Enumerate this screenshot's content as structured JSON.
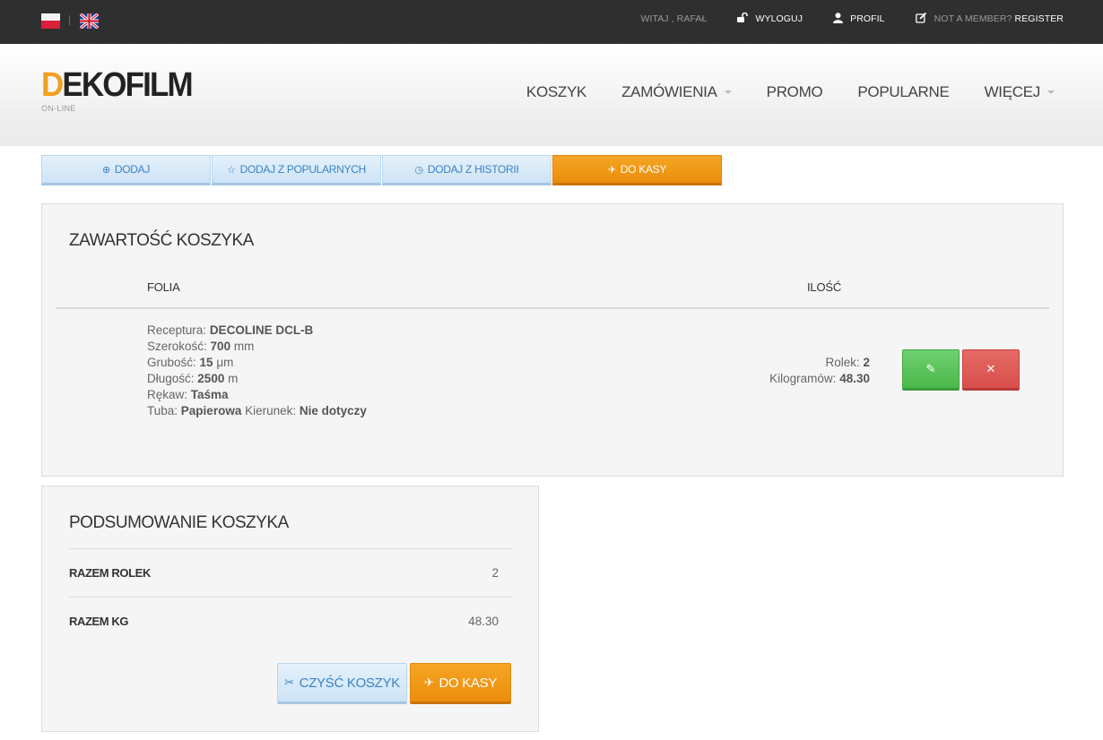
{
  "topbar": {
    "languages": [
      "pl-flag-icon",
      "uk-flag-icon"
    ],
    "greeting": "WITAJ , RAFAŁ",
    "logout_label": "WYLOGUJ",
    "logout_icon": "unlock-icon",
    "profile_label": "PROFIL",
    "profile_icon": "user-icon",
    "member_prefix": "NOT A MEMBER?",
    "register_label": "REGISTER",
    "register_icon": "edit-icon"
  },
  "header": {
    "logo_first": "D",
    "logo_rest": "EKOFILM",
    "logo_sub": "ON-LINE",
    "nav": {
      "koszyk": "KOSZYK",
      "zamowienia": "ZAMÓWIENIA",
      "promo": "PROMO",
      "popularne": "POPULARNE",
      "wiecej": "WIĘCEJ"
    }
  },
  "actions": {
    "add": {
      "icon": "⊕",
      "label": "DODAJ"
    },
    "add_popular": {
      "icon": "☆",
      "label": "DODAJ Z POPULARNYCH"
    },
    "add_history": {
      "icon": "◷",
      "label": "DODAJ Z HISTORII"
    },
    "checkout": {
      "icon": "✈",
      "label": "DO KASY"
    }
  },
  "cart": {
    "title": "ZAWARTOŚĆ KOSZYKA",
    "col_folia": "FOLIA",
    "col_ilosc": "ILOŚĆ",
    "item": {
      "receptura_label": "Receptura:",
      "receptura": "DECOLINE DCL-B",
      "szerokosc_label": "Szerokość:",
      "szerokosc": "700",
      "szerokosc_unit": "mm",
      "grubosc_label": "Grubość:",
      "grubosc": "15",
      "grubosc_unit": "μm",
      "dlugosc_label": "Długość:",
      "dlugosc": "2500",
      "dlugosc_unit": "m",
      "rekaw_label": "Rękaw:",
      "rekaw": "Taśma",
      "tuba_label": "Tuba:",
      "tuba": "Papierowa",
      "kierunek_label": "Kierunek:",
      "kierunek": "Nie dotyczy",
      "rolek_label": "Rolek:",
      "rolek": "2",
      "kg_label": "Kilogramów:",
      "kg": "48.30",
      "edit_icon": "✎",
      "delete_icon": "✕"
    }
  },
  "summary": {
    "title": "PODSUMOWANIE KOSZYKA",
    "rolek_label": "RAZEM ROLEK",
    "rolek_value": "2",
    "kg_label": "RAZEM KG",
    "kg_value": "48.30",
    "clear_icon": "✂",
    "clear_label": "CZYŚĆ KOSZYK",
    "checkout_icon": "✈",
    "checkout_label": "DO KASY"
  },
  "colors": {
    "accent_orange": "#ec8d0c",
    "light_blue": "#cde3f5",
    "success_green": "#4cb84c",
    "danger_red": "#d94f4b",
    "topbar_bg": "#2f2f2f"
  }
}
